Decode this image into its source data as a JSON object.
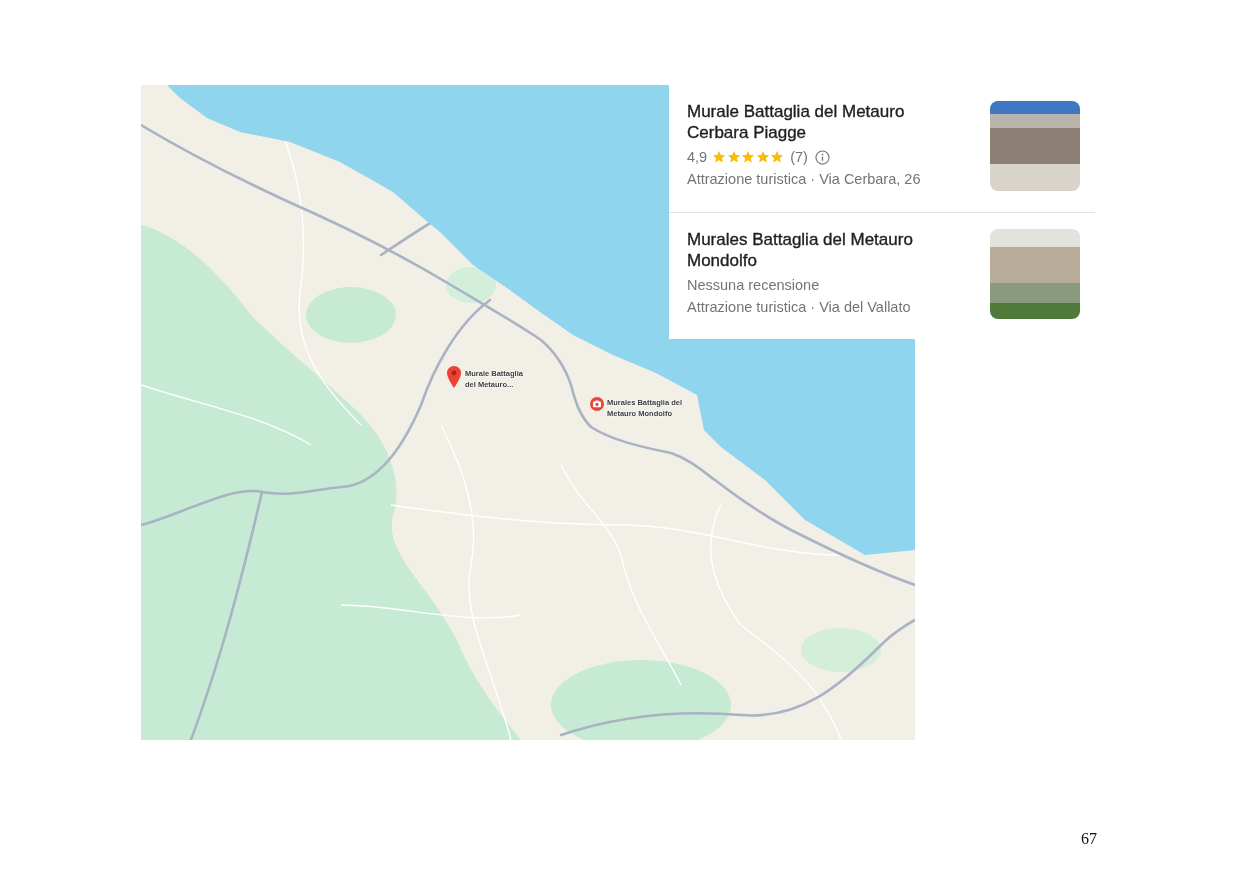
{
  "map": {
    "markers": [
      {
        "kind": "pin",
        "label": "Murale Battaglia del Metauro..."
      },
      {
        "kind": "camera",
        "label": "Murales Battaglia del Metauro Mondolfo"
      }
    ]
  },
  "places": [
    {
      "name": "Murale Battaglia del Metauro Cerbara Piagge",
      "rating": "4,9",
      "stars": 5,
      "reviews": "(7)",
      "details": "Attrazione turistica · Via Cerbara, 26"
    },
    {
      "name": "Murales Battaglia del Metauro Mondolfo",
      "review_note": "Nessuna recensione",
      "details": "Attrazione turistica · Via del Vallato"
    }
  ],
  "page_number": "67"
}
